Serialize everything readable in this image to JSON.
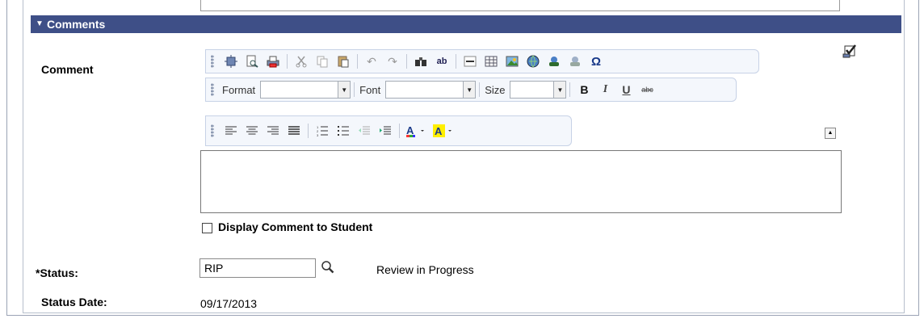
{
  "section": {
    "title": "Comments"
  },
  "comment": {
    "label": "Comment"
  },
  "toolbar": {
    "row1_icons": [
      "show-blocks-icon",
      "preview-icon",
      "print-icon",
      "cut-icon",
      "copy-icon",
      "paste-icon",
      "undo-icon",
      "redo-icon",
      "find-icon",
      "replace-icon",
      "horizontal-rule-icon",
      "table-icon",
      "image-icon",
      "link-icon",
      "unlink-icon",
      "special-char-icon"
    ],
    "format_label": "Format",
    "font_label": "Font",
    "size_label": "Size",
    "bold": "B",
    "italic": "I",
    "underline": "U",
    "strike": "abc",
    "omega": "Ω"
  },
  "display_comment": {
    "label": "Display Comment to Student",
    "checked": false
  },
  "status": {
    "label": "*Status:",
    "value": "RIP",
    "description": "Review in Progress"
  },
  "status_date": {
    "label": "Status Date:",
    "value": "09/17/2013"
  },
  "colors": {
    "header_bg": "#3e4f87",
    "toolbar_bg": "#f4f7fc"
  }
}
